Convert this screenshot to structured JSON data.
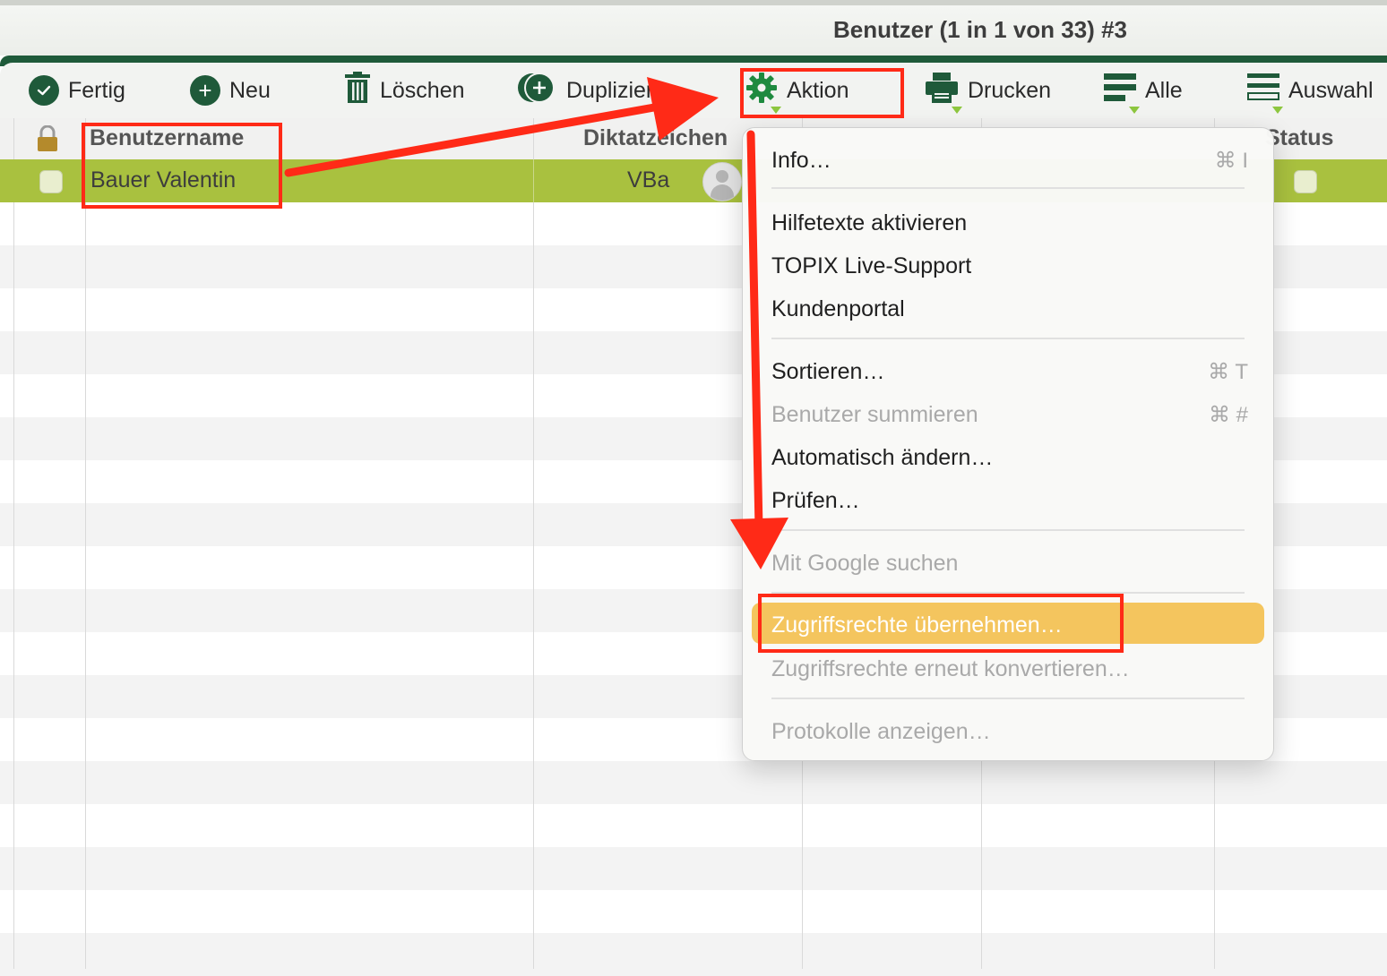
{
  "window": {
    "title": "Benutzer (1 in 1 von 33) #3"
  },
  "toolbar": {
    "done": "Fertig",
    "new": "Neu",
    "delete": "Löschen",
    "duplicate": "Duplizieren",
    "action": "Aktion",
    "print": "Drucken",
    "all": "Alle",
    "selection": "Auswahl"
  },
  "table": {
    "columns": {
      "username": "Benutzername",
      "dictation": "Diktatzeichen",
      "status": "Status"
    },
    "rows": [
      {
        "username": "Bauer Valentin",
        "dictation": "VBa"
      }
    ]
  },
  "menu": {
    "items": [
      {
        "label": "Info…",
        "shortcut": "⌘ I"
      },
      {
        "label": "Hilfetexte aktivieren"
      },
      {
        "label": "TOPIX Live-Support"
      },
      {
        "label": "Kundenportal"
      },
      {
        "label": "Sortieren…",
        "shortcut": "⌘ T"
      },
      {
        "label": "Benutzer summieren",
        "shortcut": "⌘ #"
      },
      {
        "label": "Automatisch ändern…"
      },
      {
        "label": "Prüfen…"
      },
      {
        "label": "Mit Google suchen"
      },
      {
        "label": "Zugriffsrechte übernehmen…"
      },
      {
        "label": "Zugriffsrechte erneut konvertieren…"
      },
      {
        "label": "Protokolle anzeigen…"
      }
    ]
  },
  "colors": {
    "brand_green": "#1f5a3a",
    "selection_row": "#a9c13f",
    "menu_highlight": "#f4c55e",
    "annotation_red": "#ff2a17"
  }
}
